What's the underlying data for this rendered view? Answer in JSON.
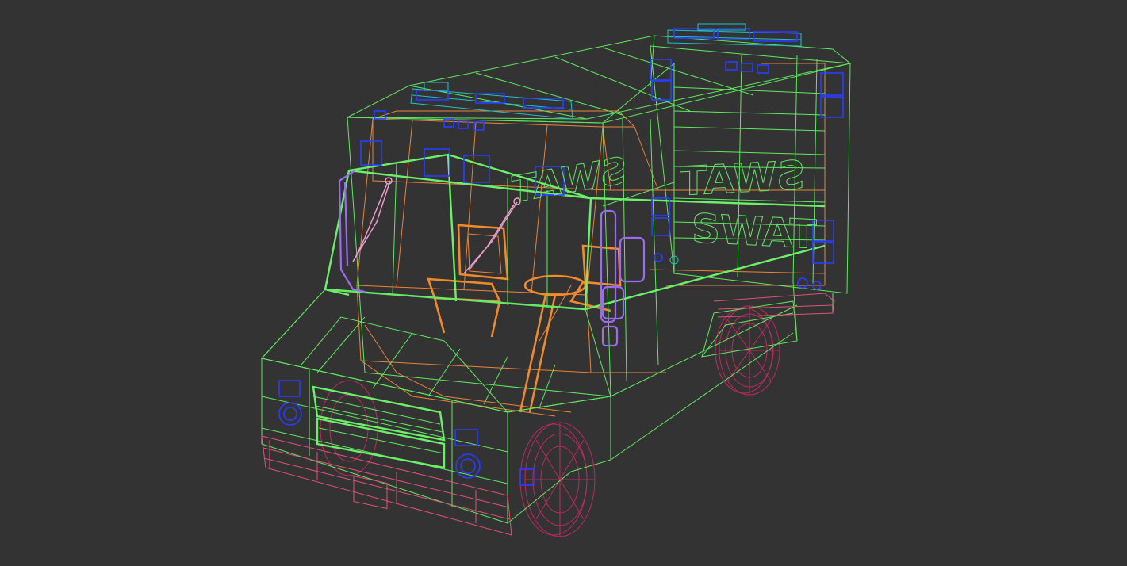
{
  "viewport": {
    "background": "#333333",
    "render_mode": "wireframe",
    "subject": "van-3d-model"
  },
  "model": {
    "text_front_mirrored": "SWAT",
    "text_side_line1": "SWAT",
    "text_side_line2": "SWAT"
  },
  "colors": {
    "body": "#5fe85f",
    "interior": "#e8843a",
    "bumper": "#e0507a",
    "wheels": "#c02860",
    "lights": "#2a3cff",
    "lightbar": "#20c0c8",
    "mirrors": "#9a6cf0"
  }
}
